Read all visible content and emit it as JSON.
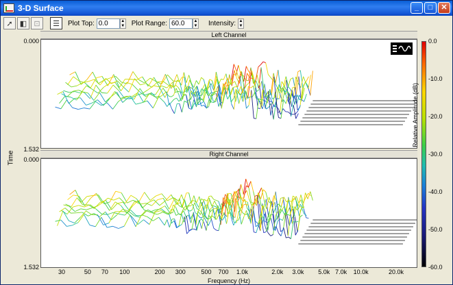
{
  "window": {
    "title": "3-D Surface"
  },
  "titlebar_buttons": {
    "minimize": "_",
    "maximize": "□",
    "close": "✕"
  },
  "toolbar": {
    "plot_top_label": "Plot Top:",
    "plot_top_value": "0.0",
    "plot_range_label": "Plot Range:",
    "plot_range_value": "60.0",
    "intensity_label": "Intensity:"
  },
  "chart_data": [
    {
      "type": "surface",
      "title": "Left Channel",
      "xlabel": "Frequency (Hz)",
      "ylabel": "Time",
      "y_ticks": [
        "0.000",
        "1.532"
      ],
      "x_scale": "log",
      "x_ticks": [
        "30",
        "50",
        "70",
        "100",
        "200",
        "300",
        "500",
        "700",
        "1.0k",
        "2.0k",
        "3.0k",
        "5.0k",
        "7.0k",
        "10.0k",
        "20.0k"
      ]
    },
    {
      "type": "surface",
      "title": "Right Channel",
      "xlabel": "Frequency (Hz)",
      "ylabel": "Time",
      "y_ticks": [
        "0.000",
        "1.532"
      ],
      "x_scale": "log",
      "x_ticks": [
        "30",
        "50",
        "70",
        "100",
        "200",
        "300",
        "500",
        "700",
        "1.0k",
        "2.0k",
        "3.0k",
        "5.0k",
        "7.0k",
        "10.0k",
        "20.0k"
      ]
    }
  ],
  "colorbar": {
    "title": "Relative Amplitude (dB)",
    "ticks": [
      "0.0",
      "-10.0",
      "-20.0",
      "-30.0",
      "-40.0",
      "-50.0",
      "-60.0"
    ],
    "range": [
      -60,
      0
    ]
  },
  "axes": {
    "time_label": "Time",
    "frequency_label": "Frequency (Hz)",
    "time_top": "0.000",
    "time_bottom": "1.532"
  }
}
